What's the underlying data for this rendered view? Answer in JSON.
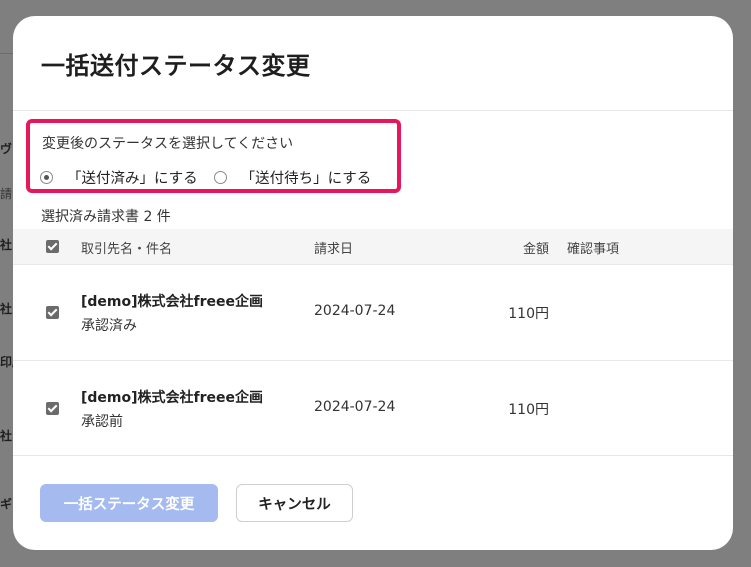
{
  "background_fragments": [
    "ヴ",
    "請",
    "社",
    "社",
    "印刷",
    "社",
    "ギ"
  ],
  "modal": {
    "title": "一括送付ステータス変更",
    "status_prompt": "変更後のステータスを選択してください",
    "radio_options": [
      {
        "label": "「送付済み」にする",
        "checked": true
      },
      {
        "label": "「送付待ち」にする",
        "checked": false
      }
    ],
    "selected_count": "選択済み請求書 2 件",
    "table": {
      "headers": {
        "name": "取引先名・件名",
        "date": "請求日",
        "amount": "金額",
        "confirm": "確認事項"
      },
      "rows": [
        {
          "name": "[demo]株式会社freee企画",
          "status": "承認済み",
          "date": "2024-07-24",
          "amount": "110円",
          "checked": true
        },
        {
          "name": "[demo]株式会社freee企画",
          "status": "承認前",
          "date": "2024-07-24",
          "amount": "110円",
          "checked": true
        }
      ]
    },
    "buttons": {
      "primary": "一括ステータス変更",
      "secondary": "キャンセル"
    }
  },
  "colors": {
    "highlight_border": "#e6185a",
    "primary_button": "#a5bbef",
    "overlay": "#7f7f7f"
  }
}
